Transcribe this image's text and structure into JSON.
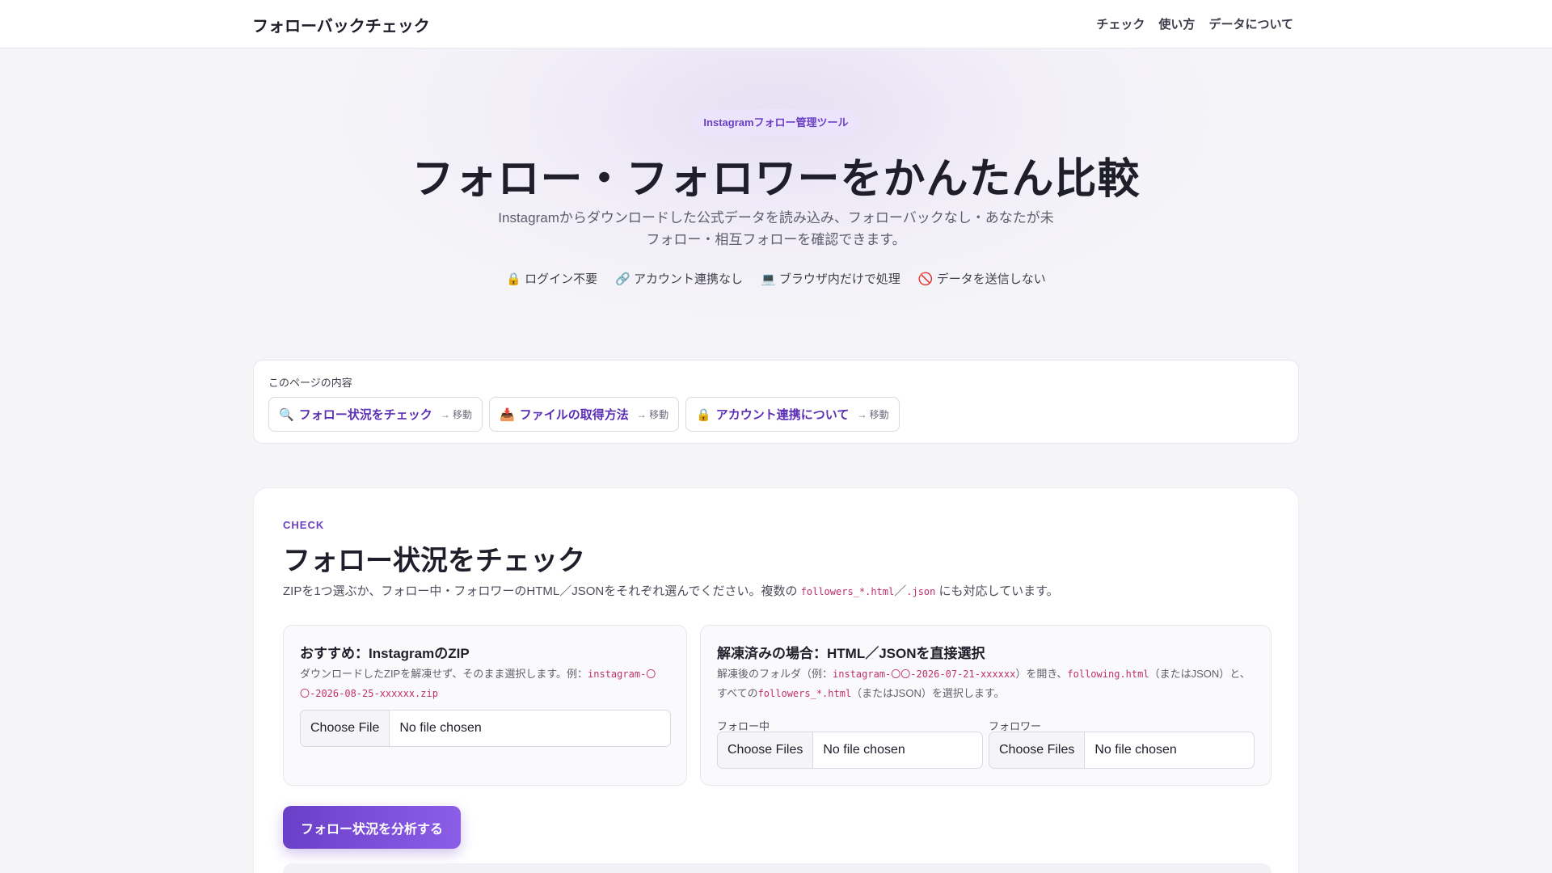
{
  "nav": {
    "brand": "フォローバックチェック",
    "links": [
      "チェック",
      "使い方",
      "データについて"
    ]
  },
  "hero": {
    "badge": "Instagramフォロー管理ツール",
    "title": "フォロー・フォロワーをかんたん比較",
    "subtitle": "Instagramからダウンロードした公式データを読み込み、フォローバックなし・あなたが未フォロー・相互フォローを確認できます。",
    "features": [
      {
        "icon": "lock-icon",
        "glyph": "🔒",
        "label": "ログイン不要"
      },
      {
        "icon": "link-icon",
        "glyph": "🔗",
        "label": "アカウント連携なし"
      },
      {
        "icon": "laptop-icon",
        "glyph": "💻",
        "label": "ブラウザ内だけで処理"
      },
      {
        "icon": "prohibited-icon",
        "glyph": "🚫",
        "label": "データを送信しない"
      }
    ]
  },
  "toc": {
    "label": "このページの内容",
    "links": [
      {
        "icon": "magnifier-icon",
        "glyph": "🔍",
        "label": "フォロー状況をチェック",
        "move": "→ 移動"
      },
      {
        "icon": "inbox-tray-icon",
        "glyph": "📥",
        "label": "ファイルの取得方法",
        "move": "→ 移動"
      },
      {
        "icon": "lock-icon",
        "glyph": "🔒",
        "label": "アカウント連携について",
        "move": "→ 移動"
      }
    ]
  },
  "check": {
    "eyebrow": "CHECK",
    "title": "フォロー状況をチェック",
    "desc_before": "ZIPを1つ選ぶか、フォロー中・フォロワーのHTML／JSONをそれぞれ選んでください。複数の ",
    "desc_code1": "followers_*.html",
    "desc_sep": "／",
    "desc_code2": ".json",
    "desc_after": " にも対応しています。",
    "zip_panel": {
      "title": "おすすめ：InstagramのZIP",
      "desc": "ダウンロードしたZIPを解凍せず、そのまま選択します。例：",
      "example": "instagram-〇〇-2026-08-25-xxxxxx.zip",
      "button": "Choose File",
      "status": "No file chosen"
    },
    "direct_panel": {
      "title": "解凍済みの場合：HTML／JSONを直接選択",
      "desc_1": "解凍後のフォルダ（例：",
      "code_1": "instagram-〇〇-2026-07-21-xxxxxx",
      "desc_2": "）を開き、",
      "code_2": "following.html",
      "desc_3": "（またはJSON）と、すべての",
      "code_3": "followers_*.html",
      "desc_4": "（またはJSON）を選択します。",
      "following_label": "フォロー中",
      "followers_label": "フォロワー",
      "button": "Choose Files",
      "status": "No file chosen"
    },
    "analyze_button": "フォロー状況を分析する"
  }
}
